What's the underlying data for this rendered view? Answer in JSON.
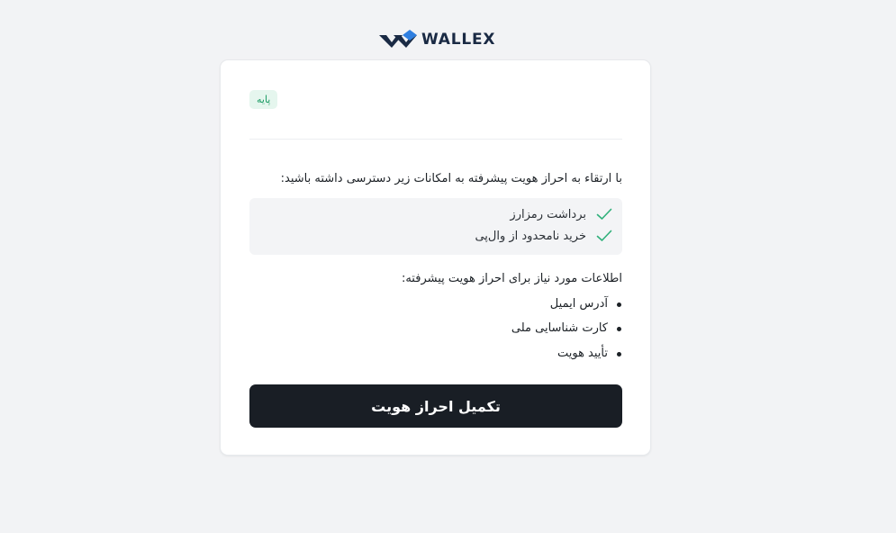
{
  "brand": {
    "name": "WALLEX",
    "color_dark": "#1a2a44",
    "color_accent": "#2f7fe0"
  },
  "card": {
    "level_badge": "پایه",
    "intro": "با ارتقاء به احراز هویت پیشرفته به امکانات زیر دسترسی داشته باشید:",
    "features": [
      {
        "icon": "check-icon",
        "label": "برداشت رمزارز"
      },
      {
        "icon": "check-icon",
        "label": "خرید نامحدود از وال‌پی"
      }
    ],
    "requirements_title": "اطلاعات مورد نیاز برای احراز هویت پیشرفته:",
    "requirements": [
      "آدرس ایمیل",
      "کارت شناسایی ملی",
      "تأیید هویت"
    ],
    "cta_label": "تکمیل احراز هویت"
  },
  "colors": {
    "background": "#f2f3f5",
    "badge_bg": "#e5f6ee",
    "badge_text": "#1a9a63",
    "check": "#2fb07a",
    "button_bg": "#191e25"
  }
}
